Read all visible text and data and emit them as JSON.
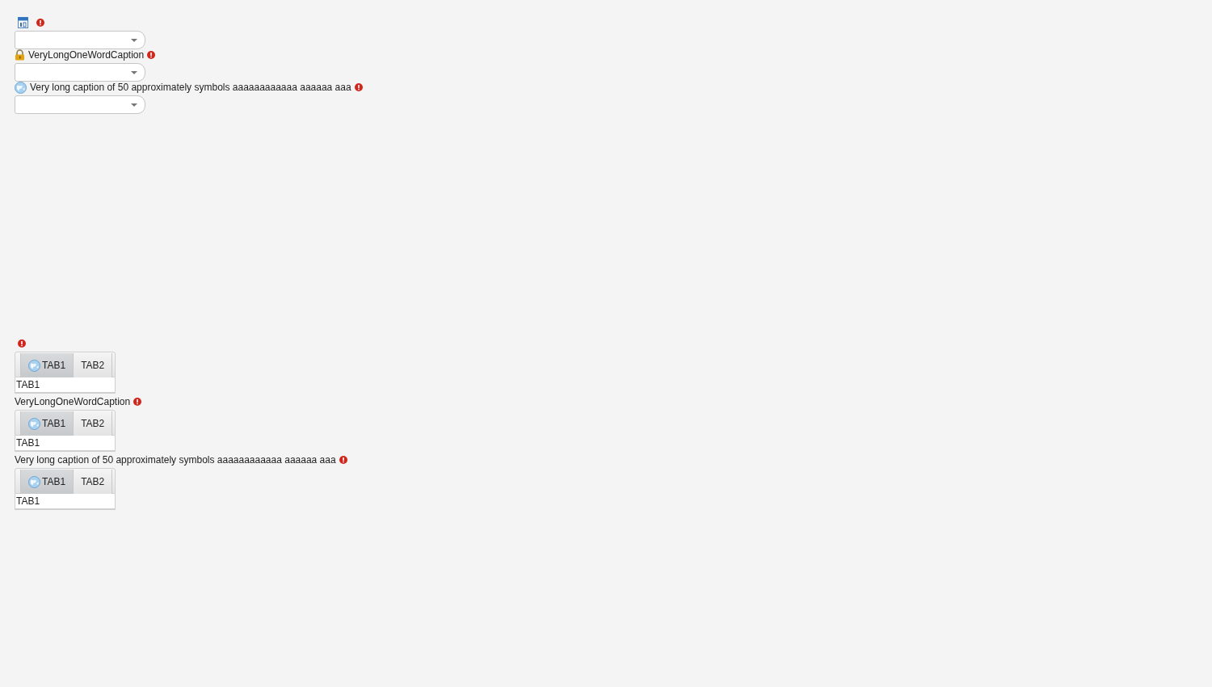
{
  "combos": [
    {
      "kind": "calendar",
      "required": true
    },
    {
      "kind": "lock",
      "caption": "VeryLongOneWordCaption",
      "required": true
    },
    {
      "kind": "globe",
      "caption": "Very long caption of 50 approximately symbols aaaaaaaaaaaa aaaaaa aaa",
      "required": true
    }
  ],
  "tabsheets": [
    {
      "required": true,
      "tabs": [
        {
          "label": "TAB1",
          "kind": "icon_tab",
          "selected": true
        },
        {
          "label": "TAB2",
          "kind": "plain_tab",
          "selected": false
        }
      ],
      "content": "TAB1"
    },
    {
      "caption": "VeryLongOneWordCaption",
      "required": true,
      "tabs": [
        {
          "label": "TAB1",
          "kind": "icon_tab",
          "selected": true
        },
        {
          "label": "TAB2",
          "kind": "plain_tab",
          "selected": false
        }
      ],
      "content": "TAB1"
    },
    {
      "caption": "Very long caption of 50 approximately symbols aaaaaaaaaaaa aaaaaa aaa",
      "required": true,
      "tabs": [
        {
          "label": "TAB1",
          "kind": "icon_tab",
          "selected": true
        },
        {
          "label": "TAB2",
          "kind": "plain_tab",
          "selected": false
        }
      ],
      "content": "TAB1"
    }
  ]
}
